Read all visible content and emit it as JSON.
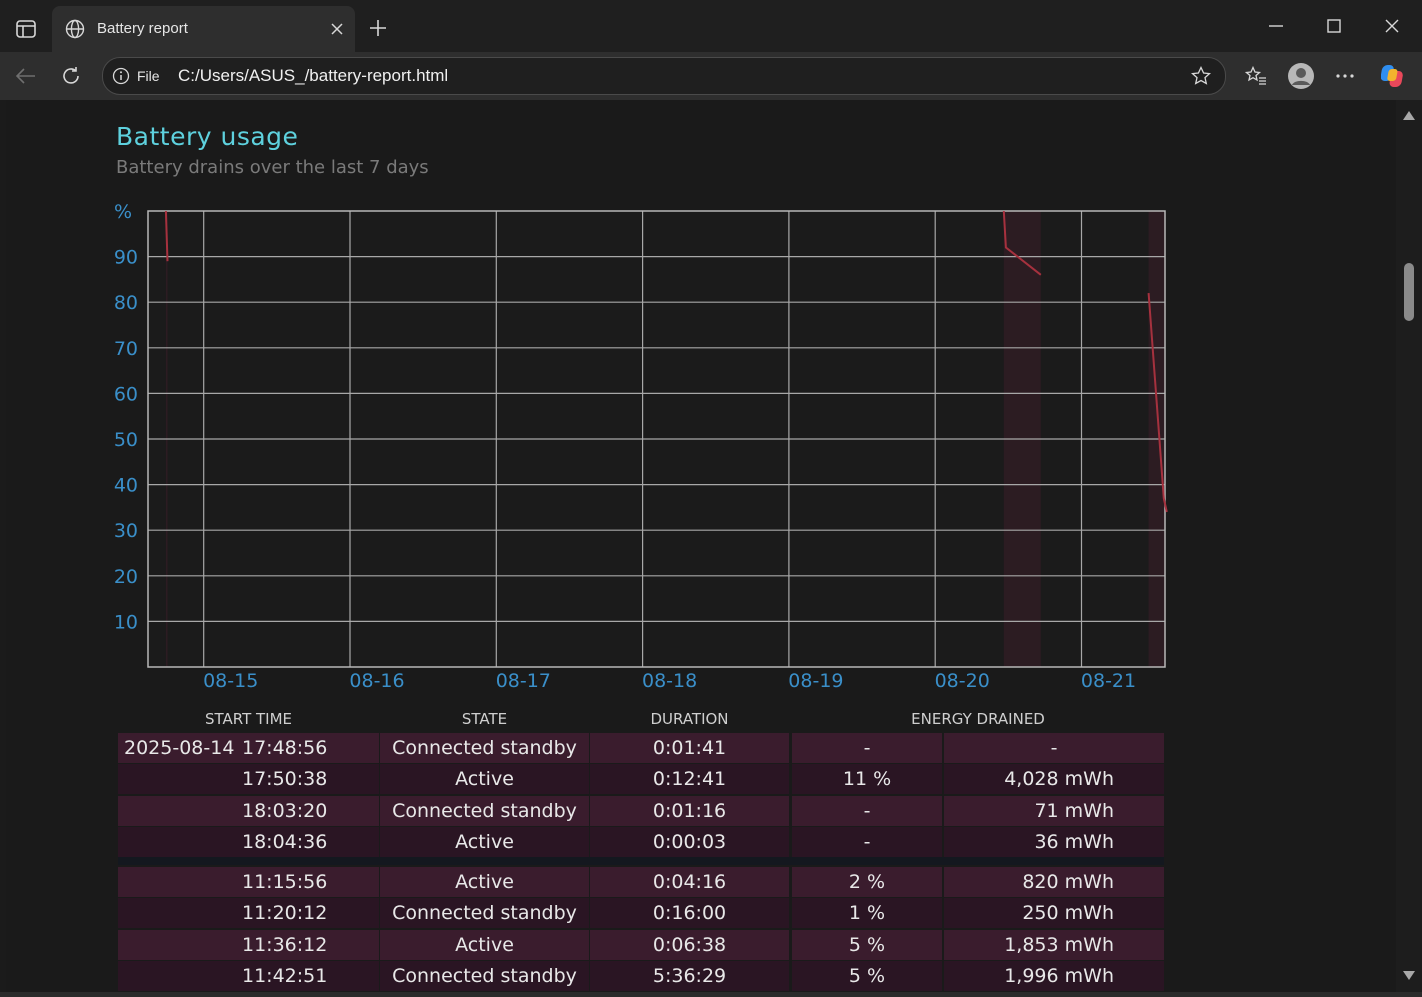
{
  "browser": {
    "tab_title": "Battery report",
    "address_scheme": "File",
    "address_url": "C:/Users/ASUS_/battery-report.html"
  },
  "page": {
    "title": "Battery usage",
    "subtitle": "Battery drains over the last 7 days"
  },
  "chart_data": {
    "type": "line",
    "title": "Battery usage",
    "subtitle": "Battery drains over the last 7 days",
    "ylabel": "%",
    "ylim": [
      0,
      100
    ],
    "yticks": [
      10,
      20,
      30,
      40,
      50,
      60,
      70,
      80,
      90
    ],
    "x_categories": [
      "08-15",
      "08-16",
      "08-17",
      "08-18",
      "08-19",
      "08-20",
      "08-21"
    ],
    "grid": true,
    "discharge_bands": [
      {
        "start": "2025-08-14 17:48",
        "end": "2025-08-14 18:04"
      },
      {
        "start": "2025-08-20 11:15",
        "end": "2025-08-20 17:19"
      },
      {
        "start": "2025-08-21 11:00",
        "end": "2025-08-21 14:00"
      }
    ],
    "series": [
      {
        "points": [
          [
            "2025-08-14 17:48",
            100
          ],
          [
            "2025-08-14 18:04",
            89
          ]
        ]
      },
      {
        "points": [
          [
            "2025-08-20 11:15",
            100
          ],
          [
            "2025-08-20 11:36",
            92
          ],
          [
            "2025-08-20 17:19",
            86
          ]
        ]
      },
      {
        "points": [
          [
            "2025-08-21 11:00",
            82
          ],
          [
            "2025-08-21 13:30",
            37
          ],
          [
            "2025-08-21 14:00",
            34
          ]
        ]
      }
    ]
  },
  "table": {
    "headers": [
      "START TIME",
      "STATE",
      "DURATION",
      "ENERGY DRAINED"
    ],
    "rows": [
      {
        "date": "2025-08-14",
        "time": "17:48:56",
        "state": "Connected standby",
        "duration": "0:01:41",
        "percent": "-",
        "energy": "-"
      },
      {
        "date": "",
        "time": "17:50:38",
        "state": "Active",
        "duration": "0:12:41",
        "percent": "11 %",
        "energy": "4,028 mWh"
      },
      {
        "date": "",
        "time": "18:03:20",
        "state": "Connected standby",
        "duration": "0:01:16",
        "percent": "-",
        "energy": "71 mWh"
      },
      {
        "date": "",
        "time": "18:04:36",
        "state": "Active",
        "duration": "0:00:03",
        "percent": "-",
        "energy": "36 mWh"
      },
      {
        "date": "",
        "time": "11:15:56",
        "state": "Active",
        "duration": "0:04:16",
        "percent": "2 %",
        "energy": "820 mWh"
      },
      {
        "date": "",
        "time": "11:20:12",
        "state": "Connected standby",
        "duration": "0:16:00",
        "percent": "1 %",
        "energy": "250 mWh"
      },
      {
        "date": "",
        "time": "11:36:12",
        "state": "Active",
        "duration": "0:06:38",
        "percent": "5 %",
        "energy": "1,853 mWh"
      },
      {
        "date": "",
        "time": "11:42:51",
        "state": "Connected standby",
        "duration": "5:36:29",
        "percent": "5 %",
        "energy": "1,996 mWh"
      }
    ]
  }
}
